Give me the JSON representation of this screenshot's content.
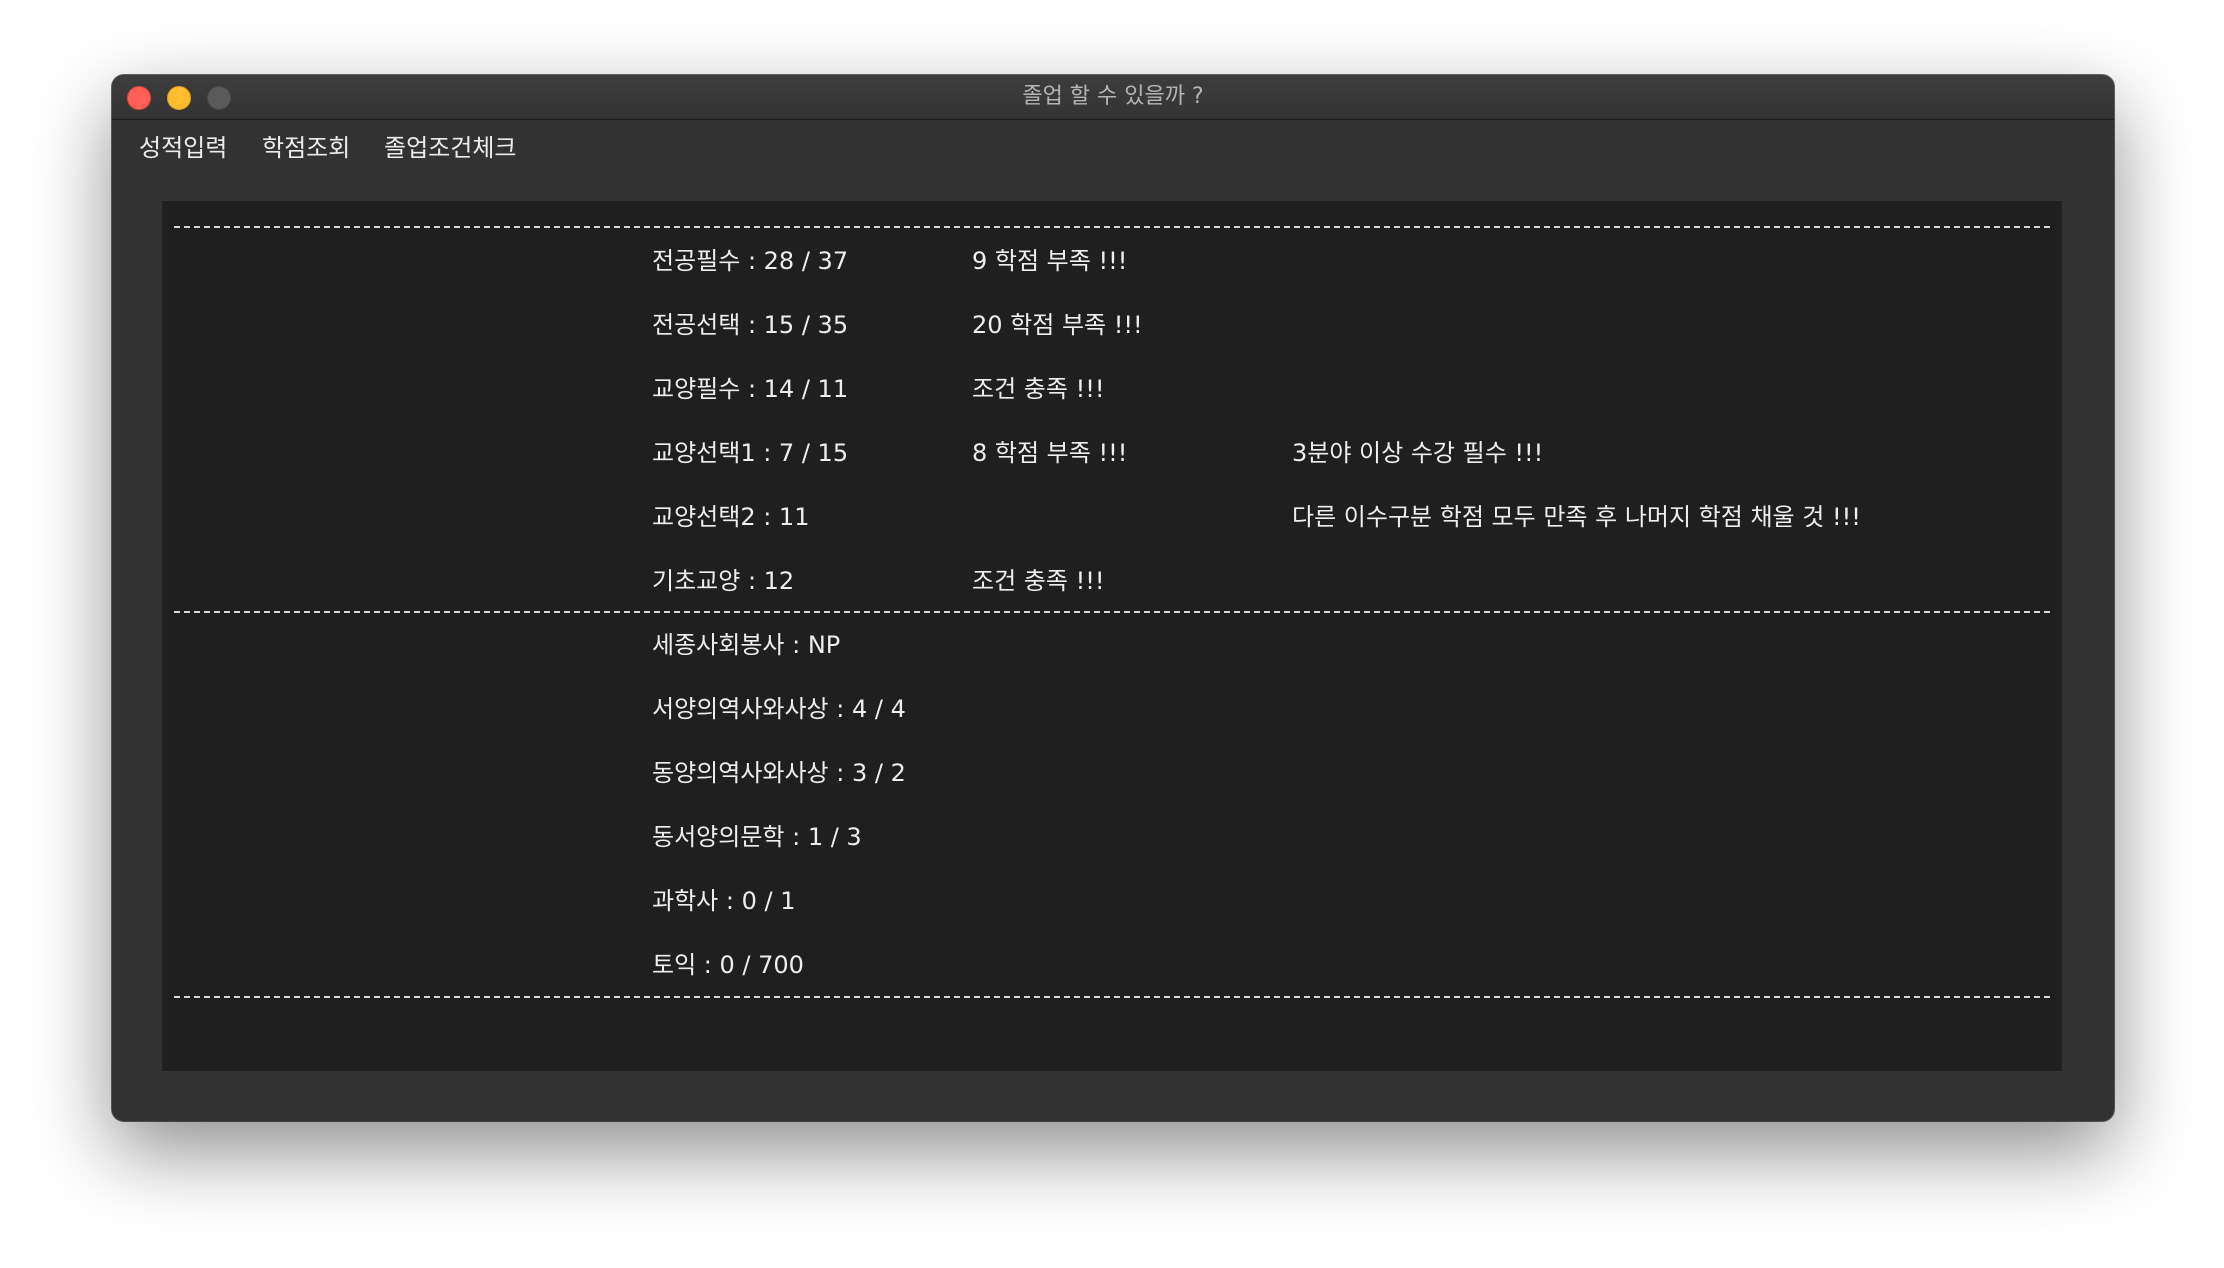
{
  "window": {
    "title": "졸업 할 수 있을까 ?"
  },
  "menu": {
    "items": [
      "성적입력",
      "학점조회",
      "졸업조건체크"
    ]
  },
  "credits": [
    {
      "label": "전공필수 : 28 / 37",
      "status": "9 학점 부족 !!!",
      "note": ""
    },
    {
      "label": "전공선택 : 15 / 35",
      "status": "20 학점 부족 !!!",
      "note": ""
    },
    {
      "label": "교양필수 : 14 / 11",
      "status": "조건 충족 !!!",
      "note": ""
    },
    {
      "label": "교양선택1 : 7 / 15",
      "status": "8 학점 부족 !!!",
      "note": "3분야 이상 수강 필수 !!!"
    },
    {
      "label": "교양선택2 : 11",
      "status": "",
      "note": "다른 이수구분 학점 모두 만족 후 나머지 학점 채울 것 !!!"
    },
    {
      "label": "기초교양 : 12",
      "status": "조건 충족 !!!",
      "note": ""
    }
  ],
  "requirements": [
    {
      "label": "세종사회봉사 : NP"
    },
    {
      "label": "서양의역사와사상 : 4 / 4"
    },
    {
      "label": "동양의역사와사상 : 3 / 2"
    },
    {
      "label": "동서양의문학 : 1 / 3"
    },
    {
      "label": "과학사 : 0 / 1"
    },
    {
      "label": "토익 : 0 / 700"
    }
  ]
}
